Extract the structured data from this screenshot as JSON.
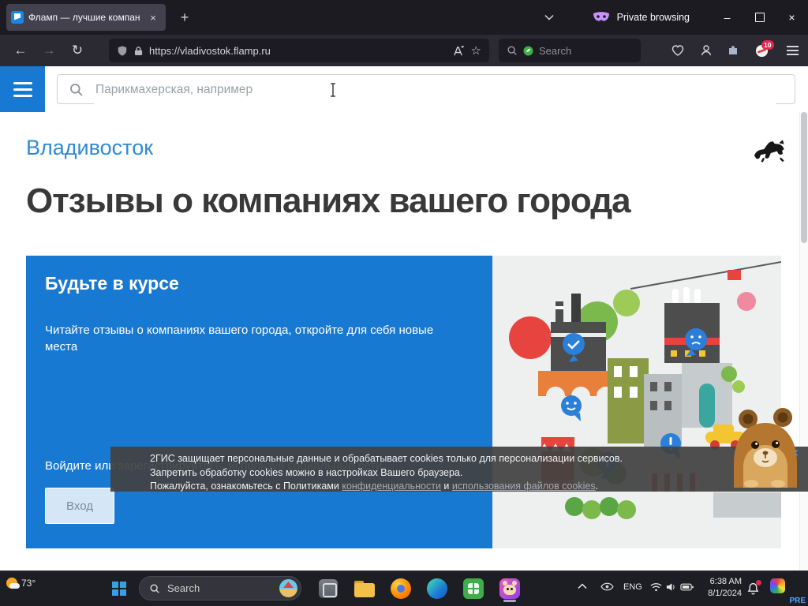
{
  "browser": {
    "tab_title": "Фламп — лучшие компании",
    "private_label": "Private browsing",
    "url": "https://vladivostok.flamp.ru",
    "search_placeholder": "Search",
    "extension_badge": "10"
  },
  "icons": {
    "back": "←",
    "forward": "→",
    "reload": "↻",
    "new_tab": "+",
    "close": "×",
    "minimize": "–",
    "star": "☆"
  },
  "page": {
    "search_placeholder": "Парикмахерская, например",
    "city": "Владивосток",
    "heading": "Отзывы о компаниях вашего города",
    "banner": {
      "title": "Будьте в курсе",
      "body": "Читайте отзывы о компаниях вашего города, откройте для себя новые места",
      "social_prompt": "Войдите или зарегистрируйтесь, используя социальные сети",
      "login_button": "Вход"
    },
    "cookie_notice": {
      "line1": "2ГИС защищает персональные данные и обрабатывает cookies только для персонализации сервисов.",
      "line2": "Запретить обработку cookies можно в настройках Вашего браузера.",
      "line3_prefix": "Пожалуйста, ознакомьтесь с Политиками ",
      "privacy_link": "конфиденциальности",
      "line3_and": " и ",
      "cookies_link": "использования файлов cookies",
      "line3_end": "."
    }
  },
  "taskbar": {
    "weather": "73°",
    "search_label": "Search",
    "language": "ENG",
    "time": "6:38 AM",
    "date": "8/1/2024",
    "watermark": "PRE"
  },
  "colors": {
    "flamp_blue": "#1879d2",
    "link_blue": "#2e8ad8",
    "bubble_blue": "#2b7fd9",
    "heading_grey": "#393939",
    "private_purple": "#c792ff"
  }
}
